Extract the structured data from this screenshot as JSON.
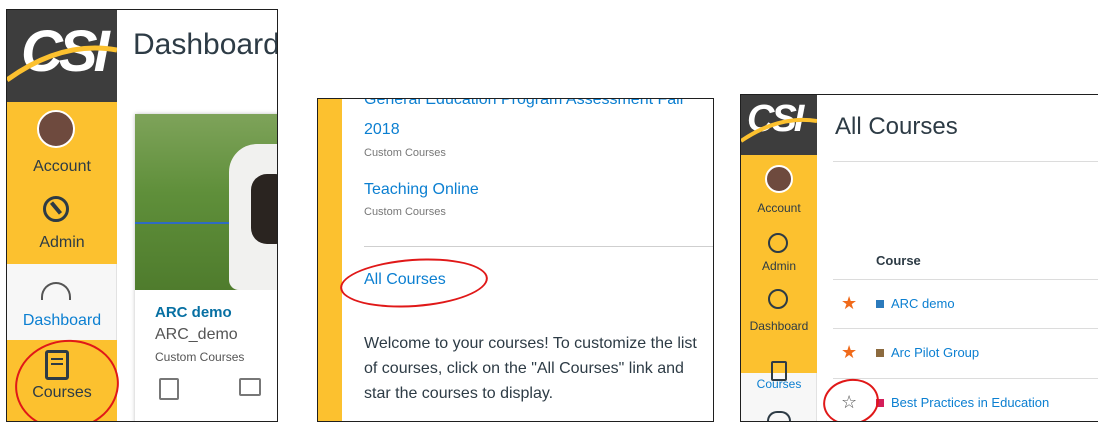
{
  "panel1": {
    "logo": "CSI",
    "nav": {
      "account_label": "Account",
      "admin_label": "Admin",
      "dashboard_label": "Dashboard",
      "courses_label": "Courses"
    },
    "page_title": "Dashboard",
    "card": {
      "title": "ARC demo",
      "code": "ARC_demo",
      "term": "Custom Courses"
    }
  },
  "panel2": {
    "items": [
      {
        "title": "General Education Program Assessment Fall",
        "title2": "2018",
        "subtitle": "Custom Courses"
      },
      {
        "title": "Teaching Online",
        "subtitle": "Custom Courses"
      }
    ],
    "all_courses_label": "All Courses",
    "welcome_text": "Welcome to your courses! To customize the list of courses, click on the \"All Courses\" link and star the courses to display."
  },
  "panel3": {
    "logo": "CSI",
    "nav": {
      "account_label": "Account",
      "admin_label": "Admin",
      "dashboard_label": "Dashboard",
      "courses_label": "Courses"
    },
    "page_title": "All Courses",
    "table_header": "Course",
    "courses": [
      {
        "name": "ARC demo",
        "starred": true,
        "star_glyph": "★",
        "color": "#2b7abc"
      },
      {
        "name": "Arc Pilot Group",
        "starred": true,
        "star_glyph": "★",
        "color": "#8c6a3e"
      },
      {
        "name": "Best Practices in Education",
        "starred": false,
        "star_glyph": "☆",
        "color": "#d41e5a"
      }
    ]
  },
  "colors": {
    "accent_yellow": "#fcc12f",
    "link_blue": "#0b7fd1",
    "star_orange": "#f06a1a",
    "annotation_red": "#e01818",
    "nav_dark": "#3d3d3d"
  }
}
